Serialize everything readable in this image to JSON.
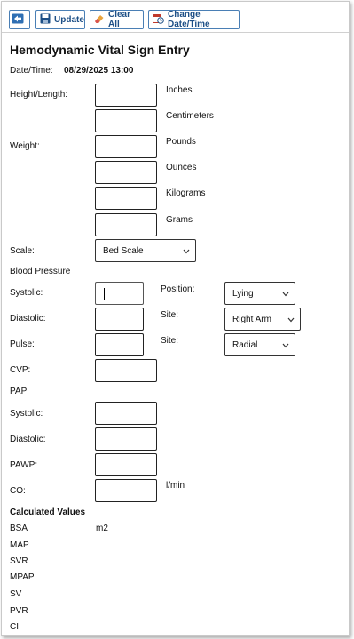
{
  "toolbar": {
    "back_label": "",
    "update_label": "Update",
    "clear_label": "Clear All",
    "change_date_label": "Change Date/Time"
  },
  "form": {
    "title": "Hemodynamic Vital Sign Entry",
    "datetime_label": "Date/Time:",
    "datetime_value": "08/29/2025 13:00",
    "height_label": "Height/Length:",
    "weight_label": "Weight:",
    "units": {
      "inches": "Inches",
      "centimeters": "Centimeters",
      "pounds": "Pounds",
      "ounces": "Ounces",
      "kilograms": "Kilograms",
      "grams": "Grams"
    },
    "scale_label": "Scale:",
    "scale_value": "Bed Scale",
    "bp_section": "Blood Pressure",
    "systolic_label": "Systolic:",
    "diastolic_label": "Diastolic:",
    "pulse_label": "Pulse:",
    "position_label": "Position:",
    "position_value": "Lying",
    "site_label": "Site:",
    "site_bp_value": "Right Arm",
    "site_pulse_value": "Radial",
    "cvp_label": "CVP:",
    "pap_section": "PAP",
    "pap_systolic_label": "Systolic:",
    "pap_diastolic_label": "Diastolic:",
    "pawp_label": "PAWP:",
    "co_label": "CO:",
    "co_unit": "l/min"
  },
  "calculated": {
    "heading": "Calculated Values",
    "bsa_label": "BSA",
    "bsa_unit": "m2",
    "map_label": "MAP",
    "svr_label": "SVR",
    "mpap_label": "MPAP",
    "sv_label": "SV",
    "pvr_label": "PVR",
    "ci_label": "CI"
  },
  "colors": {
    "button_border": "#4a7fb5",
    "button_text": "#1d4f86"
  }
}
